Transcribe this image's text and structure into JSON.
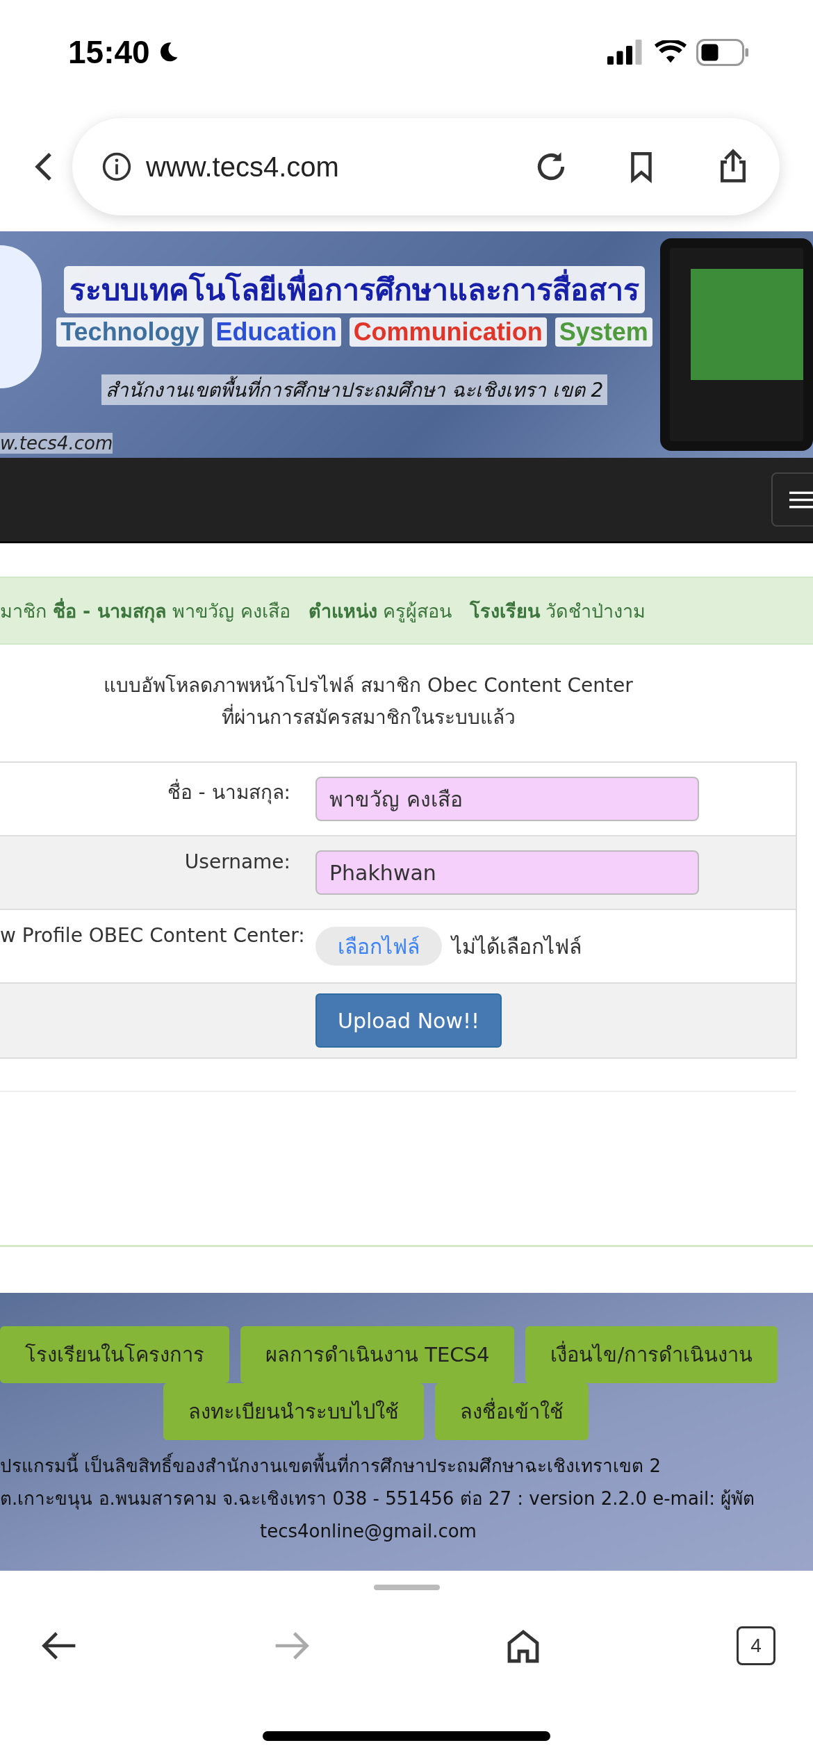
{
  "status_bar": {
    "time": "15:40"
  },
  "browser": {
    "url": "www.tecs4.com",
    "tab_count": "4"
  },
  "banner": {
    "title": "ระบบเทคโนโลยีเพื่อการศึกษาและการสื่อสาร",
    "subtitle": [
      {
        "text": "Technology",
        "color": "#3f6f9f"
      },
      {
        "text": "Education",
        "color": "#2d4fd6"
      },
      {
        "text": "Communication",
        "color": "#e0362a"
      },
      {
        "text": "System",
        "color": "#4f9a3c"
      }
    ],
    "office": "สำนักงานเขตพื้นที่การศึกษาประถมศึกษา ฉะเชิงเทรา เขต 2",
    "site": "w.tecs4.com"
  },
  "member_bar": "มาชิก **ชื่อ - นามสกุล** พาขวัญ คงเสือ   **ตำแหน่ง** ครูผู้สอน   **โรงเรียน** วัดชำป่างาม",
  "heading": [
    "แบบอัพโหลดภาพหน้าโปรไฟล์ สมาชิก Obec Content Center",
    "ที่ผ่านการสมัครสมาชิกในระบบแล้ว"
  ],
  "form": [
    {
      "kind": "field",
      "label": "ชื่อ - นามสกุล:",
      "value": "พาขวัญ คงเสือ"
    },
    {
      "kind": "field",
      "label": "Username:",
      "value": "Phakhwan"
    },
    {
      "kind": "file",
      "label": "w Profile OBEC Content Center:",
      "button": "เลือกไฟล์",
      "status": "ไม่ได้เลือกไฟล์"
    },
    {
      "kind": "submit",
      "button": "Upload Now!!"
    }
  ],
  "footer": {
    "links": [
      [
        "โรงเรียนในโครงการ",
        "ผลการดำเนินงาน TECS4",
        "เงื่อนไข/การดำเนินงาน"
      ],
      [
        "ลงทะเบียนนำระบบไปใช้",
        "ลงชื่อเข้าใช้"
      ]
    ],
    "lines": [
      "ปรแกรมนี้ เป็นลิขสิทธิ์ของสำนักงานเขตพื้นที่การศึกษาประถมศึกษาฉะเชิงเทราเขต 2",
      "ต.เกาะขนุน อ.พนมสารคาม จ.ฉะเชิงเทรา 038 - 551456 ต่อ 27 : version 2.2.0 e-mail: ผู้พัต",
      "tecs4online@gmail.com"
    ]
  }
}
